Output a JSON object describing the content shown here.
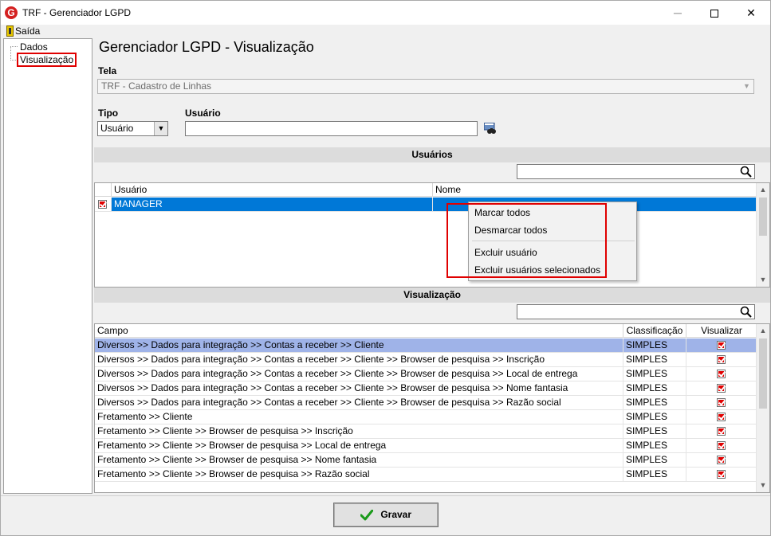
{
  "window": {
    "title": "TRF - Gerenciador LGPD",
    "app_icon": "G",
    "minimize": "─",
    "close": "✕"
  },
  "menu": {
    "exit_label": "Saída"
  },
  "tree": {
    "items": [
      {
        "label": "Dados"
      },
      {
        "label": "Visualização",
        "selected": true
      }
    ]
  },
  "page": {
    "title": "Gerenciador LGPD - Visualização"
  },
  "form": {
    "tela_label": "Tela",
    "tela_value": "TRF - Cadastro de Linhas",
    "tipo_label": "Tipo",
    "tipo_value": "Usuário",
    "usuario_label": "Usuário",
    "usuario_value": ""
  },
  "users_section": {
    "title": "Usuários",
    "search_value": "",
    "columns": [
      "Usuário",
      "Nome"
    ],
    "rows": [
      {
        "checked": true,
        "usuario": "MANAGER",
        "nome": "",
        "selected": true
      }
    ]
  },
  "context_menu": {
    "items": [
      "Marcar todos",
      "Desmarcar todos",
      "Excluir usuário",
      "Excluir usuários selecionados"
    ]
  },
  "view_section": {
    "title": "Visualização",
    "search_value": "",
    "columns": [
      "Campo",
      "Classificação",
      "Visualizar"
    ],
    "rows": [
      {
        "campo": "Diversos >> Dados para integração >> Contas a receber >> Cliente",
        "classificacao": "SIMPLES",
        "visualizar": true
      },
      {
        "campo": "Diversos >> Dados para integração >> Contas a receber >> Cliente >> Browser de pesquisa >> Inscrição",
        "classificacao": "SIMPLES",
        "visualizar": true
      },
      {
        "campo": "Diversos >> Dados para integração >> Contas a receber >> Cliente >> Browser de pesquisa >> Local de entrega",
        "classificacao": "SIMPLES",
        "visualizar": true
      },
      {
        "campo": "Diversos >> Dados para integração >> Contas a receber >> Cliente >> Browser de pesquisa >> Nome fantasia",
        "classificacao": "SIMPLES",
        "visualizar": true
      },
      {
        "campo": "Diversos >> Dados para integração >> Contas a receber >> Cliente >> Browser de pesquisa >> Razão social",
        "classificacao": "SIMPLES",
        "visualizar": true
      },
      {
        "campo": "Fretamento >> Cliente",
        "classificacao": "SIMPLES",
        "visualizar": true
      },
      {
        "campo": "Fretamento >> Cliente >> Browser de pesquisa >> Inscrição",
        "classificacao": "SIMPLES",
        "visualizar": true
      },
      {
        "campo": "Fretamento >> Cliente >> Browser de pesquisa >> Local de entrega",
        "classificacao": "SIMPLES",
        "visualizar": true
      },
      {
        "campo": "Fretamento >> Cliente >> Browser de pesquisa >> Nome fantasia",
        "classificacao": "SIMPLES",
        "visualizar": true
      },
      {
        "campo": "Fretamento >> Cliente >> Browser de pesquisa >> Razão social",
        "classificacao": "SIMPLES",
        "visualizar": true
      }
    ]
  },
  "footer": {
    "save_label": "Gravar"
  },
  "colors": {
    "highlight_red": "#e00000",
    "selection_blue": "#0078d7",
    "row_highlight": "#9fb3e8"
  }
}
